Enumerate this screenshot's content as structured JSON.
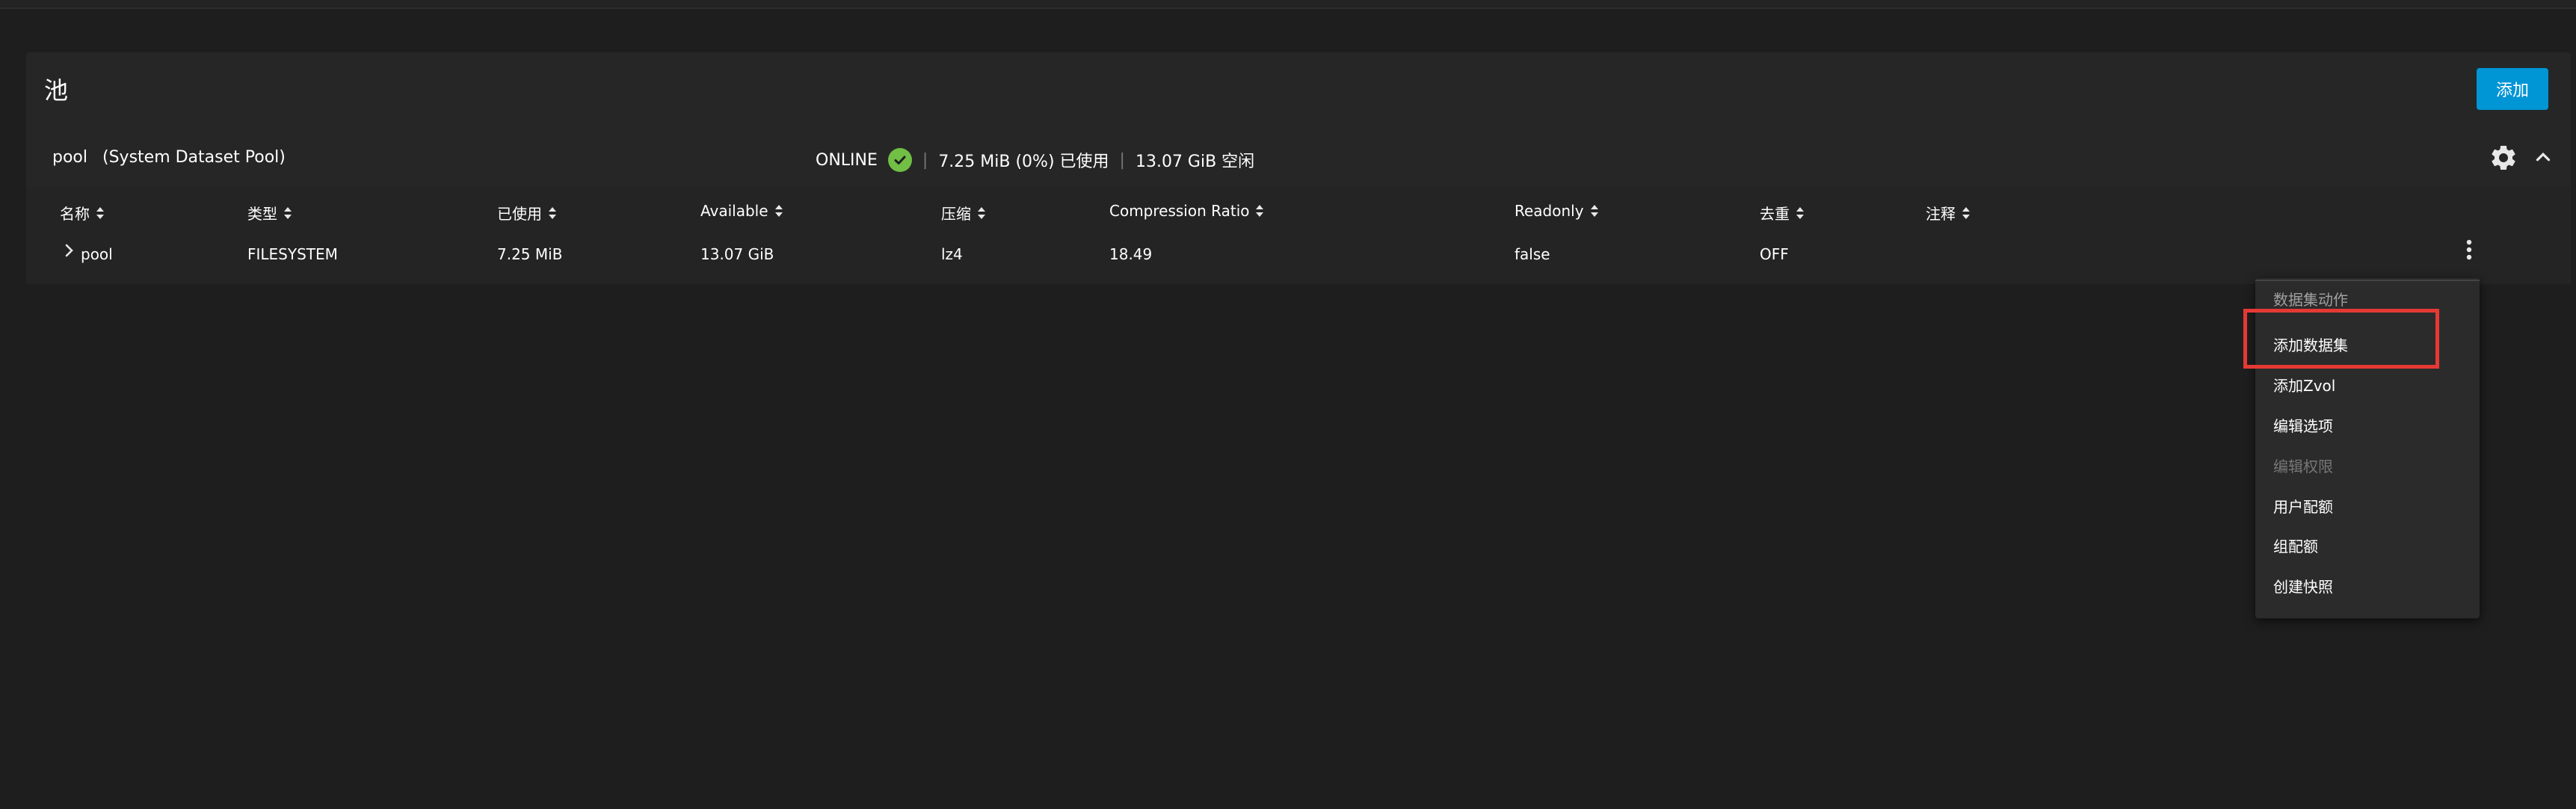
{
  "page": {
    "title": "池",
    "add_label": "添加"
  },
  "pool": {
    "name": "pool",
    "description": "(System Dataset Pool)",
    "status": "ONLINE",
    "used": "7.25 MiB (0%) 已使用",
    "free": "13.07 GiB 空闲",
    "separator": "|"
  },
  "table": {
    "columns": [
      "名称",
      "类型",
      "已使用",
      "Available",
      "压缩",
      "Compression Ratio",
      "Readonly",
      "去重",
      "注释"
    ],
    "rows": [
      {
        "name": "pool",
        "type": "FILESYSTEM",
        "used": "7.25 MiB",
        "available": "13.07 GiB",
        "compression": "lz4",
        "ratio": "18.49",
        "readonly": "false",
        "dedup": "OFF",
        "comments": ""
      }
    ]
  },
  "menu": {
    "header": "数据集动作",
    "items": [
      {
        "label": "添加数据集",
        "enabled": true
      },
      {
        "label": "添加Zvol",
        "enabled": true
      },
      {
        "label": "编辑选项",
        "enabled": true
      },
      {
        "label": "编辑权限",
        "enabled": false
      },
      {
        "label": "用户配额",
        "enabled": true
      },
      {
        "label": "组配额",
        "enabled": true
      },
      {
        "label": "创建快照",
        "enabled": true
      }
    ]
  },
  "icons": {
    "status_ok": "check-circle-icon",
    "settings": "gear-icon",
    "collapse": "chevron-up-icon",
    "expand_row": "chevron-right-icon",
    "row_menu": "more-vert-icon",
    "sort": "sort-icon"
  },
  "colors": {
    "accent": "#0095d5",
    "status_ok": "#71bf44",
    "highlight": "#e53935"
  }
}
